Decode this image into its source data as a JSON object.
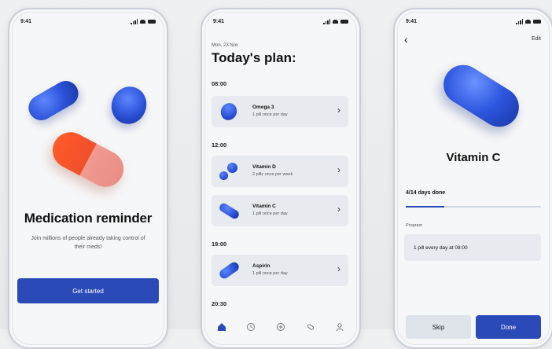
{
  "status_time": "9:41",
  "onboarding": {
    "title": "Medication reminder",
    "subtitle": "Join millions of people already taking control of their meds!",
    "cta": "Get started"
  },
  "plan": {
    "date": "Mon, 23 Nov",
    "title": "Today's plan:",
    "times": [
      "08:00",
      "12:00",
      "19:00",
      "20:30"
    ],
    "items": [
      {
        "name": "Omega 3",
        "dose": "1 pill once per day",
        "icon": "omega-pill-icon"
      },
      {
        "name": "Vitamin D",
        "dose": "2 pills once per week",
        "icon": "vitamin-d-pills-icon"
      },
      {
        "name": "Vitamin C",
        "dose": "1 pill once per day",
        "icon": "vitamin-c-capsule-icon"
      },
      {
        "name": "Aspirin",
        "dose": "1 pill once per day",
        "icon": "aspirin-capsule-icon"
      }
    ],
    "tabbar": [
      "home-icon",
      "clock-icon",
      "plus-icon",
      "pills-icon",
      "profile-icon"
    ]
  },
  "detail": {
    "edit": "Edit",
    "name": "Vitamin C",
    "progress_text": "4/14 days done",
    "progress_fraction": 0.2857,
    "program_label": "Program",
    "program_text": "1 pill every day at 08:00",
    "skip": "Skip",
    "done": "Done"
  },
  "colors": {
    "accent": "#2a4ab8",
    "pill_blue": "#2a50d6",
    "pill_orange": "#f0502b"
  }
}
